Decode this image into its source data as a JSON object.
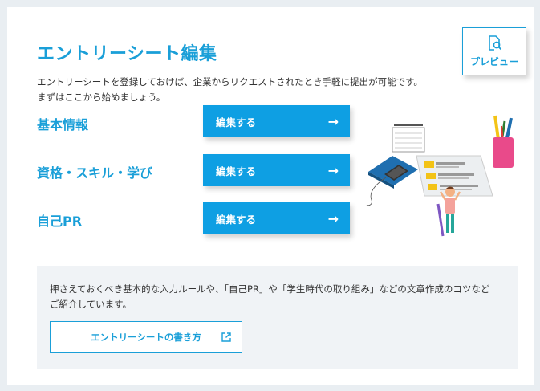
{
  "page": {
    "title": "エントリーシート編集",
    "description_line1": "エントリーシートを登録しておけば、企業からリクエストされたとき手軽に提出が可能です。",
    "description_line2": "まずはここから始めましょう。"
  },
  "preview": {
    "label": "プレビュー",
    "icon": "document-search-icon"
  },
  "sections": [
    {
      "label": "基本情報",
      "button": "編集する"
    },
    {
      "label": "資格・スキル・学び",
      "button": "編集する"
    },
    {
      "label": "自己PR",
      "button": "編集する"
    }
  ],
  "info": {
    "line1": "押さえておくべき基本的な入力ルールや、「自己PR」や「学生時代の取り組み」などの文章作成のコツなど",
    "line2": "ご紹介しています。",
    "link_label": "エントリーシートの書き方",
    "link_icon": "external-link-icon"
  },
  "colors": {
    "accent": "#1a9fd8",
    "button": "#0e9fe3",
    "panel": "#f0f3f6"
  }
}
